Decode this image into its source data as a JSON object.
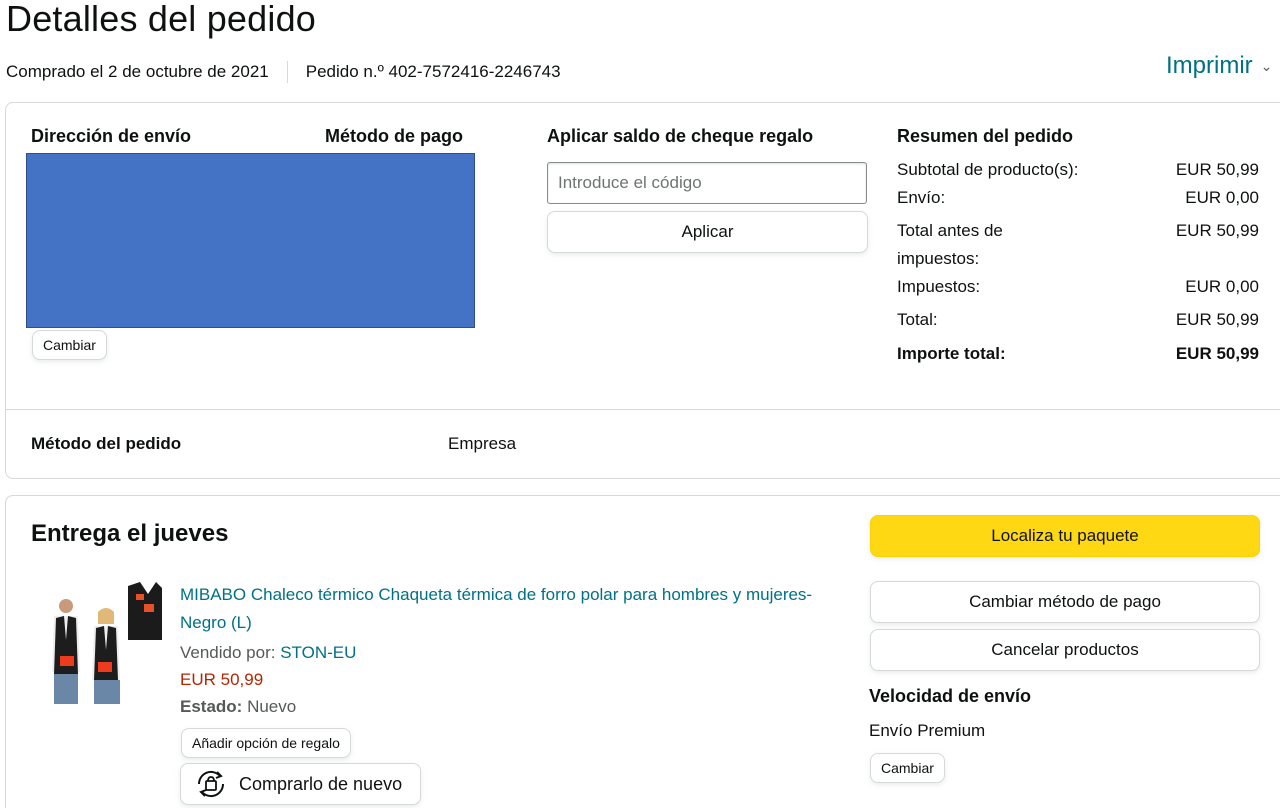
{
  "page": {
    "title": "Detalles del pedido",
    "purchase_date": "Comprado el 2 de octubre de 2021",
    "order_number": "Pedido n.º 402-7572416-2246743",
    "print_label": "Imprimir"
  },
  "top_card": {
    "shipping_address_heading": "Dirección de envío",
    "payment_method_heading": "Método de pago",
    "change_label": "Cambiar",
    "gift_card_heading": "Aplicar saldo de cheque regalo",
    "gift_code_placeholder": "Introduce el código",
    "apply_label": "Aplicar",
    "summary": {
      "heading": "Resumen del pedido",
      "rows": [
        {
          "label": "Subtotal de producto(s):",
          "value": "EUR 50,99"
        },
        {
          "label": "Envío:",
          "value": "EUR 0,00"
        },
        {
          "label": "Total antes de impuestos:",
          "value": "EUR 50,99"
        },
        {
          "label": "Impuestos:",
          "value": "EUR 0,00"
        },
        {
          "label": "Total:",
          "value": "EUR 50,99"
        },
        {
          "label": "Importe total:",
          "value": "EUR 50,99"
        }
      ]
    },
    "order_method_label": "Método del pedido",
    "order_method_value": "Empresa"
  },
  "delivery": {
    "heading": "Entrega el jueves",
    "track_label": "Localiza tu paquete",
    "change_payment_label": "Cambiar método de pago",
    "cancel_items_label": "Cancelar productos",
    "shipping_speed_heading": "Velocidad de envío",
    "shipping_speed_value": "Envío Premium",
    "change_label": "Cambiar",
    "product": {
      "title": "MIBABO Chaleco térmico Chaqueta térmica de forro polar para hombres y mujeres-Negro (L)",
      "sold_by_label": "Vendido por:",
      "seller": "STON-EU",
      "price": "EUR 50,99",
      "condition_label": "Estado:",
      "condition_value": "Nuevo",
      "gift_option_label": "Añadir opción de regalo",
      "buy_again_label": "Comprarlo de nuevo"
    }
  },
  "colors": {
    "link": "#007185",
    "price": "#B12704",
    "primary_button": "#FFD814",
    "redaction": "#4472C4"
  },
  "icons": [
    "buy-again-icon",
    "chevron-down-icon"
  ]
}
